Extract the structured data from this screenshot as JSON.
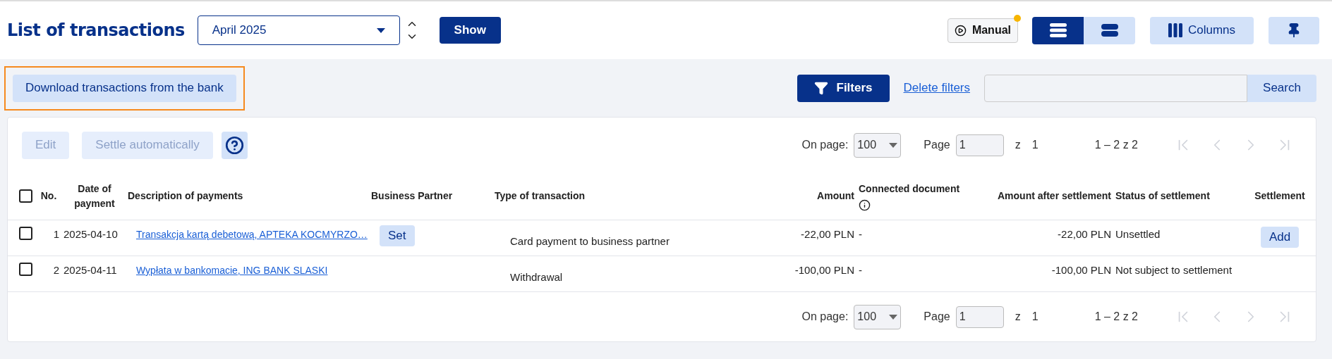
{
  "header": {
    "title": "List of transactions",
    "period": {
      "value": "April 2025"
    },
    "show_button": "Show",
    "manual": {
      "label": "Manual",
      "notification": true
    },
    "view_modes": [
      {
        "kind": "compact",
        "selected": true
      },
      {
        "kind": "wide",
        "selected": false
      }
    ],
    "columns_button": "Columns"
  },
  "toolbar": {
    "download": {
      "label": "Download transactions from the bank",
      "highlighted": true
    },
    "filters": "Filters",
    "delete_filters": "Delete filters",
    "search_button": "Search"
  },
  "actions": [
    {
      "label": "Edit",
      "disabled": true
    },
    {
      "label": "Settle automatically",
      "disabled": true
    }
  ],
  "pagers": [
    {
      "on_page_label": "On page:",
      "per_page": "100",
      "page_label": "Page",
      "page": "1",
      "of": "z",
      "total_pages": "1",
      "range": "1 – 2 z 2",
      "nav": [
        {
          "kind": "first",
          "disabled": true
        },
        {
          "kind": "prev",
          "disabled": true
        },
        {
          "kind": "next",
          "disabled": true
        },
        {
          "kind": "last",
          "disabled": true
        }
      ]
    },
    {
      "on_page_label": "On page:",
      "per_page": "100",
      "page_label": "Page",
      "page": "1",
      "of": "z",
      "total_pages": "1",
      "range": "1 – 2 z 2",
      "nav": [
        {
          "kind": "first",
          "disabled": true
        },
        {
          "kind": "prev",
          "disabled": true
        },
        {
          "kind": "next",
          "disabled": true
        },
        {
          "kind": "last",
          "disabled": true
        }
      ]
    }
  ],
  "table": {
    "select_all": {
      "checked": false
    },
    "columns": [
      {
        "label": "No."
      },
      {
        "label": "Date of payment"
      },
      {
        "label": "Description of payments"
      },
      {
        "label": "Business Partner"
      },
      {
        "label": "Type of transaction"
      },
      {
        "label": "Amount"
      },
      {
        "label": "Connected document",
        "info_icon": true
      },
      {
        "label": "Amount after settlement"
      },
      {
        "label": "Status of settlement"
      },
      {
        "label": "Settlement"
      }
    ],
    "rows": [
      {
        "checked": false,
        "no": "1",
        "date": "2025-04-10",
        "description": "Transakcja kartą debetową, APTEKA KOCMYRZO…",
        "partner_button": "Set",
        "type": "Card payment to business partner",
        "amount": "-22,00 PLN",
        "document": "-",
        "amount_after": "-22,00 PLN",
        "status": "Unsettled",
        "settlement_button": "Add"
      },
      {
        "checked": false,
        "no": "2",
        "date": "2025-04-11",
        "description": "Wypłata w bankomacie, ING BANK SLASKI",
        "type": "Withdrawal",
        "amount": "-100,00 PLN",
        "document": "-",
        "amount_after": "-100,00 PLN",
        "status": "Not subject to settlement"
      }
    ]
  }
}
